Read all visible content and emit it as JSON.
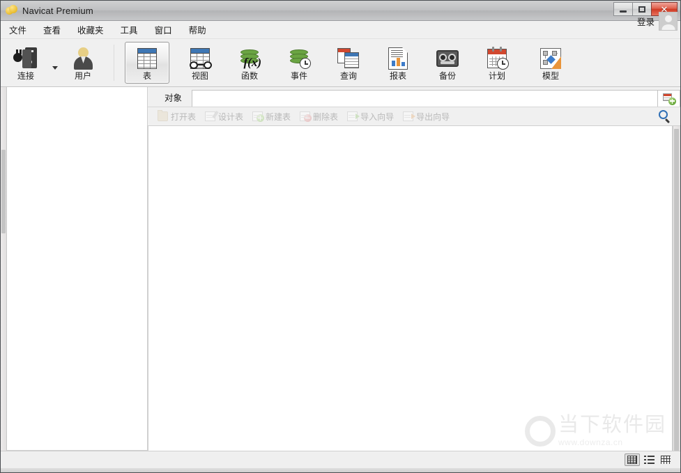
{
  "window": {
    "title": "Navicat Premium",
    "app_icon": "navicat-logo-icon",
    "controls": {
      "minimize": "minimize-icon",
      "restore": "restore-icon",
      "close": "close-icon"
    }
  },
  "menubar": {
    "items": [
      {
        "label": "文件",
        "name": "menu-file"
      },
      {
        "label": "查看",
        "name": "menu-view"
      },
      {
        "label": "收藏夹",
        "name": "menu-favorites"
      },
      {
        "label": "工具",
        "name": "menu-tools"
      },
      {
        "label": "窗口",
        "name": "menu-window"
      },
      {
        "label": "帮助",
        "name": "menu-help"
      }
    ],
    "login_label": "登录",
    "avatar": "user-avatar-placeholder"
  },
  "toolbar": {
    "items": [
      {
        "label": "连接",
        "icon": "connection-icon",
        "has_dropdown": true,
        "selected": false
      },
      {
        "label": "用户",
        "icon": "user-icon",
        "has_dropdown": false,
        "selected": false
      },
      {
        "label": "表",
        "icon": "table-icon",
        "has_dropdown": false,
        "selected": true
      },
      {
        "label": "视图",
        "icon": "view-icon",
        "has_dropdown": false,
        "selected": false
      },
      {
        "label": "函数",
        "icon": "function-icon",
        "has_dropdown": false,
        "selected": false
      },
      {
        "label": "事件",
        "icon": "event-icon",
        "has_dropdown": false,
        "selected": false
      },
      {
        "label": "查询",
        "icon": "query-icon",
        "has_dropdown": false,
        "selected": false
      },
      {
        "label": "报表",
        "icon": "report-icon",
        "has_dropdown": false,
        "selected": false
      },
      {
        "label": "备份",
        "icon": "backup-icon",
        "has_dropdown": false,
        "selected": false
      },
      {
        "label": "计划",
        "icon": "schedule-icon",
        "has_dropdown": false,
        "selected": false
      },
      {
        "label": "模型",
        "icon": "model-icon",
        "has_dropdown": false,
        "selected": false
      }
    ]
  },
  "object_bar": {
    "tab_label": "对象",
    "field_value": "",
    "add_tab_icon": "new-object-tab-icon"
  },
  "action_bar": {
    "actions": [
      {
        "label": "打开表",
        "icon": "open-table-icon"
      },
      {
        "label": "设计表",
        "icon": "design-table-icon"
      },
      {
        "label": "新建表",
        "icon": "new-table-icon"
      },
      {
        "label": "删除表",
        "icon": "delete-table-icon"
      },
      {
        "label": "导入向导",
        "icon": "import-wizard-icon"
      },
      {
        "label": "导出向导",
        "icon": "export-wizard-icon"
      }
    ],
    "search_icon": "search-icon"
  },
  "sidebar": {
    "items": []
  },
  "content": {
    "items": []
  },
  "watermark": {
    "main": "当下软件园",
    "sub": "www.downza.cn",
    "logo": "ring-logo-icon"
  },
  "statusbar": {
    "view_modes": [
      {
        "name": "grid-view-button",
        "icon": "grid-icon",
        "active": true
      },
      {
        "name": "list-view-button",
        "icon": "list-icon",
        "active": false
      },
      {
        "name": "detail-view-button",
        "icon": "detail-icon",
        "active": false
      }
    ]
  },
  "colors": {
    "accent_blue": "#3e77b5",
    "close_red": "#cf3a25",
    "green": "#6aa442",
    "orange": "#e8943a",
    "toolbar_bg": "#f0f0f0"
  }
}
